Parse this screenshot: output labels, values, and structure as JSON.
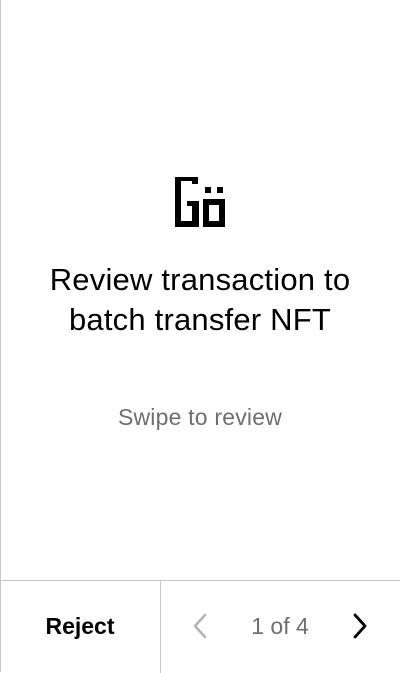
{
  "logo": {
    "icon": "go-logo-icon",
    "text": "Gö"
  },
  "review": {
    "title": "Review transaction to batch transfer NFT",
    "subtitle": "Swipe to review"
  },
  "footer": {
    "reject_label": "Reject",
    "prev_icon": "chevron-left-icon",
    "next_icon": "chevron-right-icon",
    "page_indicator": "1 of 4",
    "current_page": 1,
    "total_pages": 4
  },
  "colors": {
    "background": "#ffffff",
    "text_primary": "#000000",
    "text_secondary": "#6f6f6f",
    "disabled_arrow": "#b5b5b5",
    "divider": "#c9c9c9"
  }
}
